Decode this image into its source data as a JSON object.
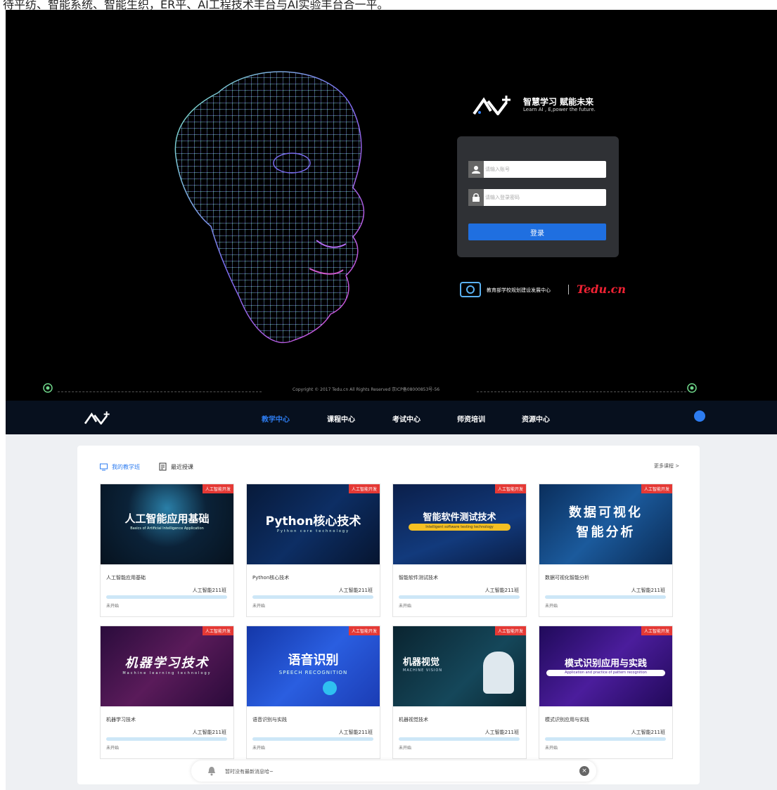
{
  "top_stripe_text": "待平纺、智能系统、智能生织，ER平、AI工程技术丰台与AI实验丰台合一平。",
  "login": {
    "slogan": "智慧学习 赋能未来",
    "slogan_sub": "Learn AI , E,power the future.",
    "account_placeholder": "请输入账号",
    "password_placeholder": "请输入登录密码",
    "login_button": "登录",
    "partner_text": "教育部学校规划建设发展中心",
    "partner_logo_text": "Tedu.cn",
    "copyright": "Copyright © 2017 Tedu.cn All Rights Reserved 京ICP备08000853号-56"
  },
  "nav": {
    "items": [
      {
        "label": "教学中心",
        "active": true
      },
      {
        "label": "课程中心",
        "active": false
      },
      {
        "label": "考试中心",
        "active": false
      },
      {
        "label": "师资培训",
        "active": false
      },
      {
        "label": "资源中心",
        "active": false
      }
    ]
  },
  "tabs": {
    "my_classes": "我的教学班",
    "recent": "最近授课",
    "more": "更多课程 >"
  },
  "courses": [
    {
      "tag": "人工智能开发",
      "img_title": "人工智能应用基础",
      "img_sub": "Basics of Artificial Intelligence Application",
      "title": "人工智能应用基础",
      "class_name": "人工智能211班",
      "status": "未开始"
    },
    {
      "tag": "人工智能开发",
      "img_title": "Python核心技术",
      "img_sub": "Python core technology",
      "title": "Python核心技术",
      "class_name": "人工智能211班",
      "status": "未开始"
    },
    {
      "tag": "人工智能开发",
      "img_title": "智能软件测试技术",
      "img_sub": "Intelligent software testing technology",
      "title": "智能软件测试技术",
      "class_name": "人工智能211班",
      "status": "未开始"
    },
    {
      "tag": "人工智能开发",
      "img_title": "数据可视化",
      "img_title2": "智能分析",
      "title": "数据可视化智能分析",
      "class_name": "人工智能211班",
      "status": "未开始"
    },
    {
      "tag": "人工智能开发",
      "img_title": "机器学习技术",
      "img_sub": "Machine learning technology",
      "title": "机器学习技术",
      "class_name": "人工智能211班",
      "status": "未开始"
    },
    {
      "tag": "人工智能开发",
      "img_title": "语音识别",
      "img_sub": "SPEECH RECOGNITION",
      "title": "语音识别与实践",
      "class_name": "人工智能211班",
      "status": "未开始"
    },
    {
      "tag": "人工智能开发",
      "img_title": "机器视觉",
      "img_sub": "MACHINE VISION",
      "title": "机器视觉技术",
      "class_name": "人工智能211班",
      "status": "未开始"
    },
    {
      "tag": "人工智能开发",
      "img_title": "模式识别应用与实践",
      "img_sub": "Application and practice of pattern recognition",
      "title": "模式识别应用与实践",
      "class_name": "人工智能211班",
      "status": "未开始"
    }
  ],
  "message": {
    "text": "暂时没有最新消息哈~",
    "close": "×"
  },
  "colors": {
    "accent": "#2d7cf0",
    "login_button": "#1f6fe0",
    "tag": "#e53935",
    "nav_bg": "#07101e",
    "progress": "#cde7f7"
  }
}
